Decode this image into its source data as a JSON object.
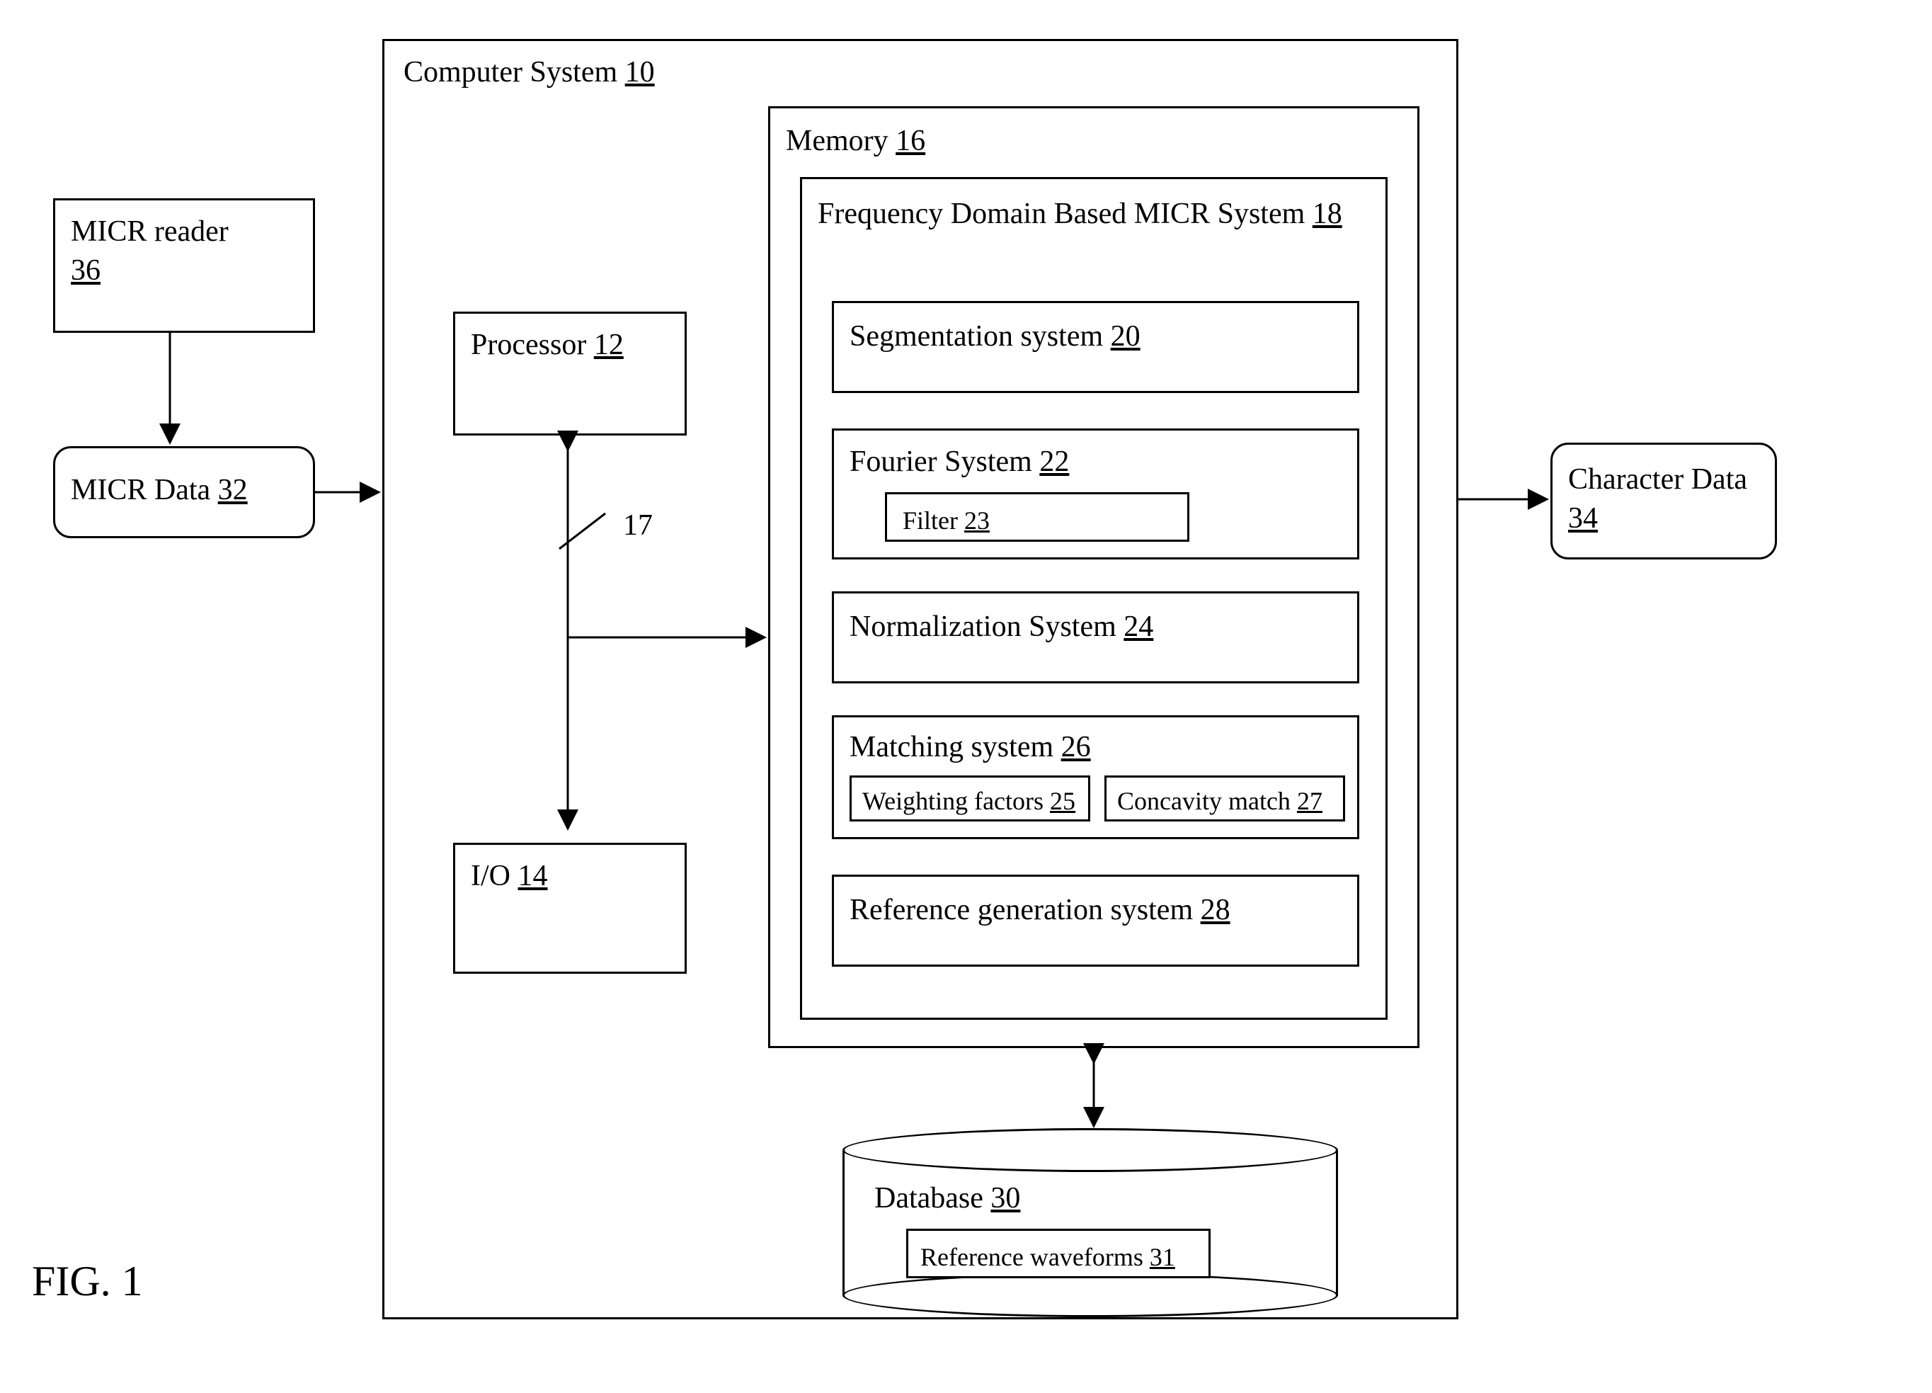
{
  "fig": "FIG. 1",
  "micr_reader": {
    "label": "MICR reader",
    "num": "36"
  },
  "micr_data": {
    "label": "MICR Data",
    "num": "32"
  },
  "char_data": {
    "label": "Character Data",
    "num": "34"
  },
  "computer": {
    "label": "Computer System",
    "num": "10"
  },
  "processor": {
    "label": "Processor",
    "num": "12"
  },
  "io": {
    "label": "I/O",
    "num": "14"
  },
  "bus_num": "17",
  "memory": {
    "label": "Memory",
    "num": "16"
  },
  "fdm": {
    "label": "Frequency Domain Based MICR System",
    "num": "18"
  },
  "segmentation": {
    "label": "Segmentation system",
    "num": "20"
  },
  "fourier": {
    "label": "Fourier System",
    "num": "22"
  },
  "filter": {
    "label": "Filter",
    "num": "23"
  },
  "normalization": {
    "label": "Normalization System",
    "num": "24"
  },
  "matching": {
    "label": "Matching system",
    "num": "26"
  },
  "weighting": {
    "label": "Weighting factors",
    "num": "25"
  },
  "concavity": {
    "label": "Concavity match",
    "num": "27"
  },
  "reference": {
    "label": "Reference generation system",
    "num": "28"
  },
  "database": {
    "label": "Database",
    "num": "30"
  },
  "ref_wave": {
    "label": "Reference waveforms",
    "num": "31"
  }
}
